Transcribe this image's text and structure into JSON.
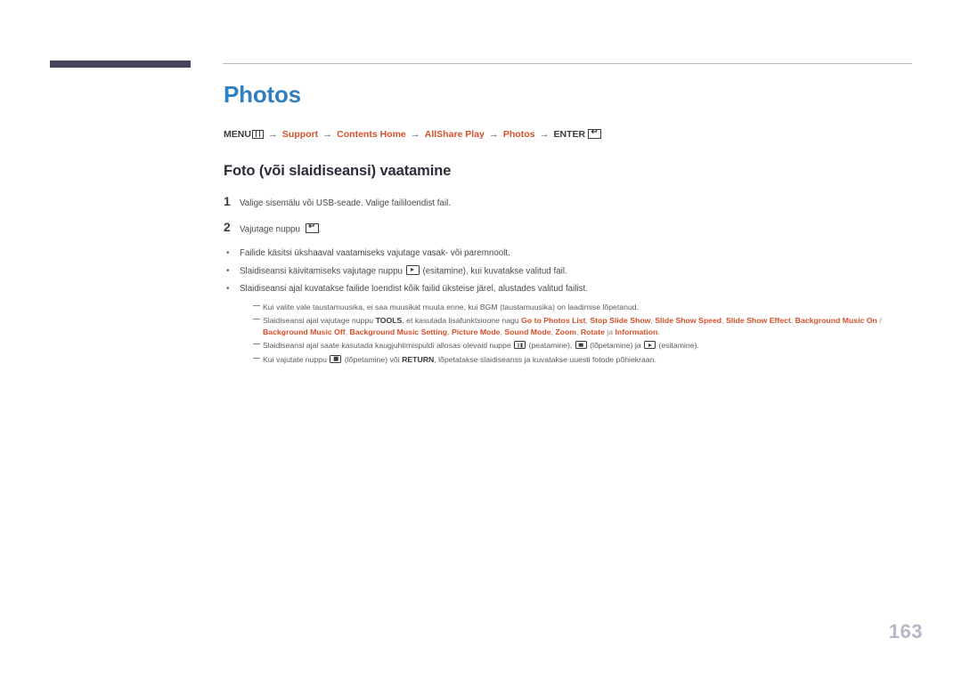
{
  "document": {
    "page_number": "163",
    "page_title": "Photos",
    "section_heading": "Foto (või slaidiseansi) vaatamine"
  },
  "breadcrumb": {
    "root_label": "MENU",
    "menu_icon": "menu-box-icon",
    "arrow": "→",
    "items": [
      {
        "label": "Support"
      },
      {
        "label": "Contents Home"
      },
      {
        "label": "AllShare Play"
      },
      {
        "label": "Photos"
      }
    ],
    "end_label": "ENTER",
    "enter_icon": "enter-return-icon",
    "enter_glyph": "↵"
  },
  "steps": [
    {
      "number": "1",
      "text": "Valige sisemälu või USB-seade. Valige faililoendist fail."
    },
    {
      "number": "2",
      "text_before": "Vajutage nuppu",
      "icon": "enter-return-icon",
      "icon_glyph": "↵",
      "text_after": "."
    }
  ],
  "bullets": [
    {
      "text": "Failide käsitsi ükshaaval vaatamiseks vajutage vasak- või paremnoolt."
    },
    {
      "text_before": "Slaidiseansi käivitamiseks vajutage nuppu",
      "icon": "play-button-icon",
      "text_after": "(esitamine), kui kuvatakse valitud fail."
    },
    {
      "text": "Slaidiseansi ajal kuvatakse failide loendist kõik failid üksteise järel, alustades valitud failist."
    }
  ],
  "notes": [
    {
      "id": "note-bgm-loading",
      "text": "Kui valite vale taustamuusika, ei saa muusikat muuta enne, kui BGM (taustamuusika) on laadimise lõpetanud."
    },
    {
      "id": "note-tools",
      "line1_before": "Slaidiseansi ajal vajutage nuppu",
      "tools_label": "TOOLS",
      "line1_middle": ", et kasutada lisafunktsioone nagu",
      "options_line1": [
        "Go to Photos List",
        "Stop Slide Show",
        "Slide Show Speed",
        "Slide Show Effect"
      ],
      "options_line2_a": "Background Music On",
      "options_slash": "/",
      "options_line2": [
        "Background Music Off",
        "Background Music Setting",
        "Picture Mode",
        "Sound Mode",
        "Zoom",
        "Rotate"
      ],
      "conjunction": "ja",
      "options_last": "Information",
      "terminator": "."
    },
    {
      "id": "note-remote-buttons",
      "before": "Slaidiseansi ajal saate kasutada kaugjuhtimispuldi allosas olevaid nuppe",
      "pause_icon": "pause-button-icon",
      "pause_label": "(peatamine),",
      "stop_icon": "stop-button-icon",
      "stop_label": "(lõpetamine) ja",
      "play_icon": "play-button-icon",
      "play_label": "(esitamine)."
    },
    {
      "id": "note-return",
      "before": "Kui vajutate nuppu",
      "stop_icon": "stop-button-icon",
      "middle": "(lõpetamine) või",
      "return_label": "RETURN",
      "after": ", lõpetatakse slaidiseanss ja kuvatakse uuesti fotode põhiekraan."
    }
  ],
  "colors": {
    "title_blue": "#2f7fc1",
    "accent_orange": "#d4502a",
    "header_block": "#474258",
    "page_number": "#b8b6c6"
  }
}
